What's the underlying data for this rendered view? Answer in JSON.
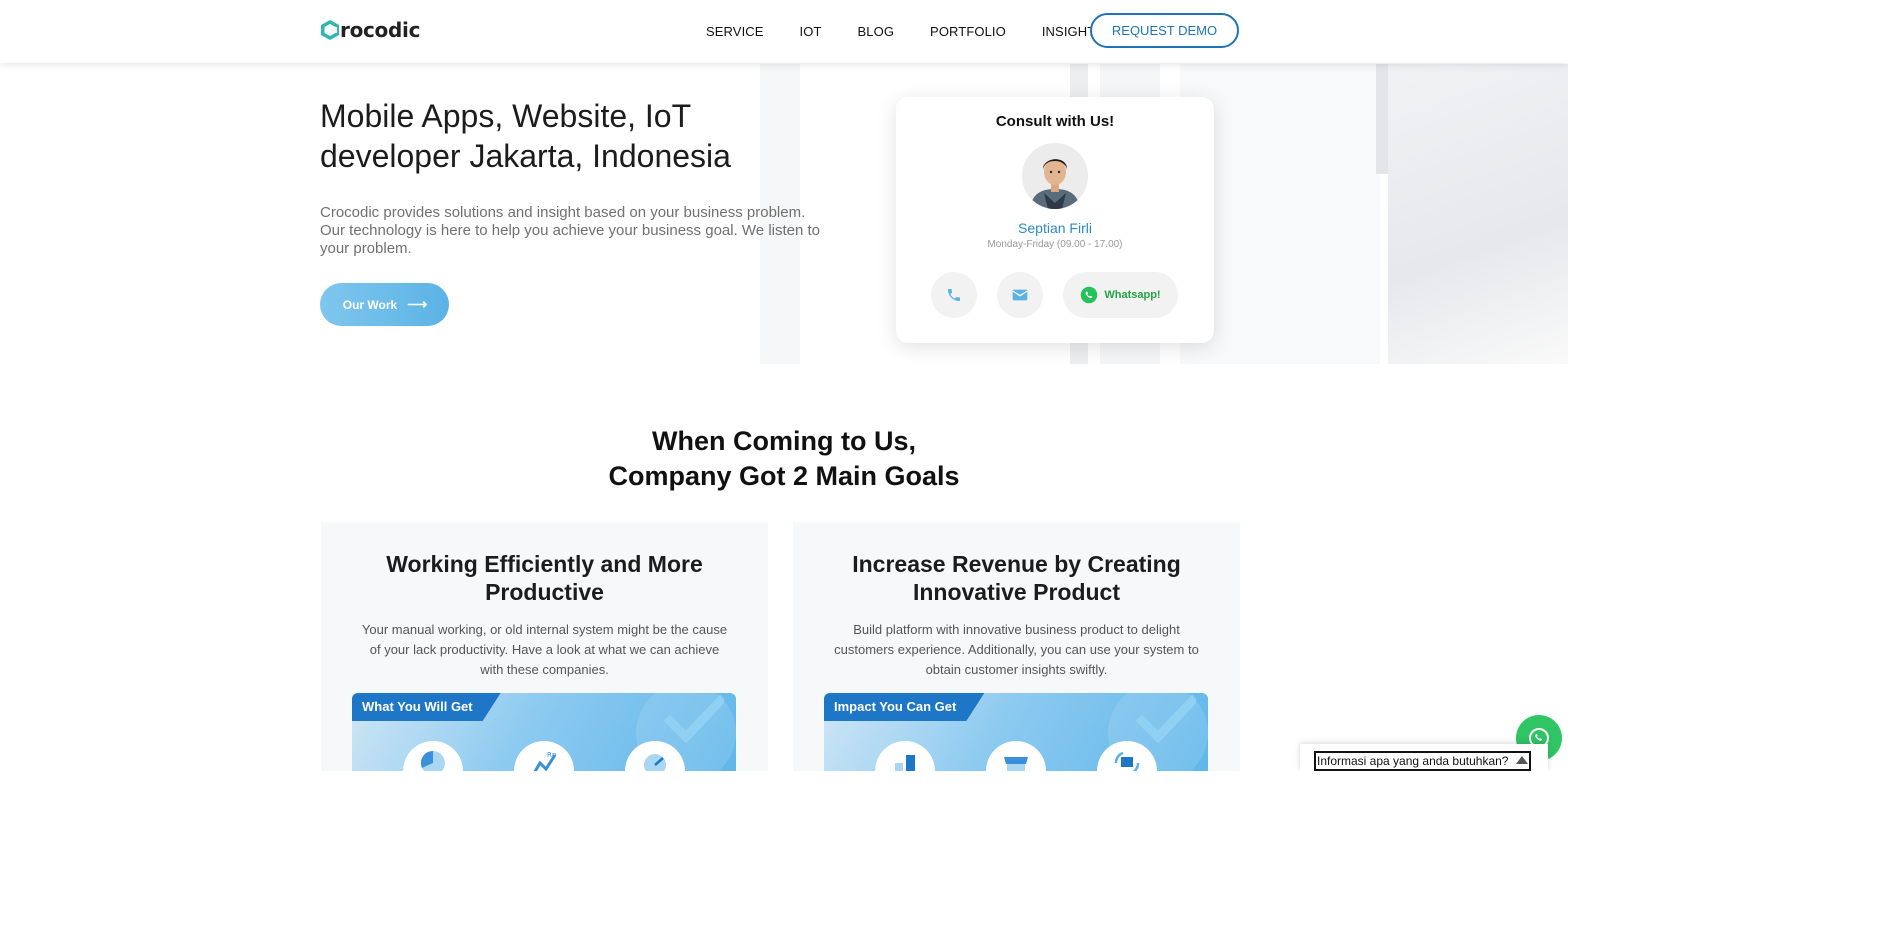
{
  "header": {
    "logo_text": "rocodic",
    "logo_alt": "Crocodic",
    "nav": [
      {
        "label": "SERVICE"
      },
      {
        "label": "IOT"
      },
      {
        "label": "BLOG"
      },
      {
        "label": "PORTFOLIO"
      },
      {
        "label": "INSIGHT"
      }
    ],
    "demo_label": "REQUEST DEMO"
  },
  "hero": {
    "title_line1": "Mobile Apps, Website, IoT",
    "title_line2": "developer Jakarta, Indonesia",
    "description": "Crocodic provides solutions and insight based on your business problem. Our technology is here to help you achieve your business goal. We listen to your problem.",
    "cta_label": "Our Work",
    "cta_arrow": "⟶"
  },
  "consult": {
    "title": "Consult with Us!",
    "name": "Septian Firli",
    "hours": "Monday-Friday (09.00 - 17.00)",
    "whatsapp_label": "Whatsapp!"
  },
  "goals": {
    "title_line1": "When Coming to Us,",
    "title_line2": "Company Got 2 Main Goals",
    "cards": [
      {
        "heading": "Working Efficiently and More Productive",
        "description": "Your manual working, or old internal system might be the cause of your lack productivity. Have a look at what we can achieve with these companies.",
        "panel_label": "What You Will Get"
      },
      {
        "heading": "Increase Revenue by Creating Innovative Product",
        "description": "Build platform with innovative business product to delight customers experience. Additionally, you can use your system to obtain customer insights swiftly.",
        "panel_label": "Impact You Can Get"
      }
    ]
  },
  "chat": {
    "placeholder": "Informasi apa yang anda butuhkan?"
  },
  "colors": {
    "brand_blue": "#1f73b7",
    "accent_light_blue": "#5bb3e5",
    "whatsapp_green": "#2fc565",
    "teal_logo": "#2fb6b0"
  },
  "icons": {
    "phone": "phone-icon",
    "email": "envelope-icon",
    "whatsapp": "whatsapp-icon",
    "arrow": "arrow-right-icon"
  }
}
